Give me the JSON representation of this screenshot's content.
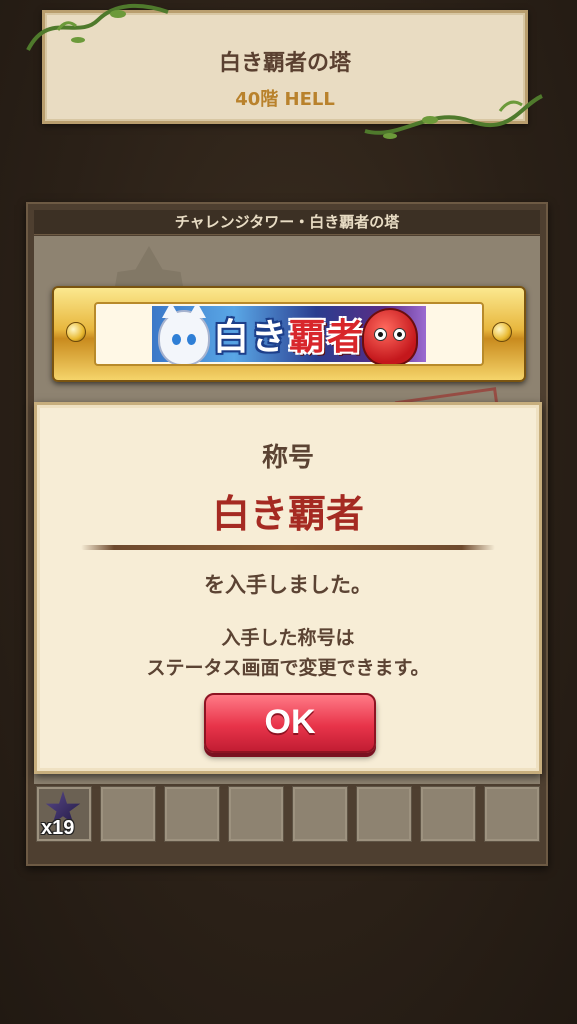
{
  "header": {
    "title": "白き覇者の塔",
    "subtitle": "40階 HELL"
  },
  "panel": {
    "title": "チャレンジタワー・白き覇者の塔"
  },
  "banner": {
    "text_white": "白き",
    "text_red": "覇者"
  },
  "dialog": {
    "label": "称号",
    "title_name": "白き覇者",
    "obtained": "を入手しました。",
    "note_line1": "入手した称号は",
    "note_line2": "ステータス画面で変更できます。",
    "ok_label": "OK"
  },
  "inventory": {
    "first_item_icon": "dark-star-icon",
    "first_item_count": "x19",
    "slot_count": 8
  },
  "colors": {
    "ok_button": "#e8344a",
    "title_red": "#a52a22",
    "subtitle_gold": "#b9822c"
  }
}
